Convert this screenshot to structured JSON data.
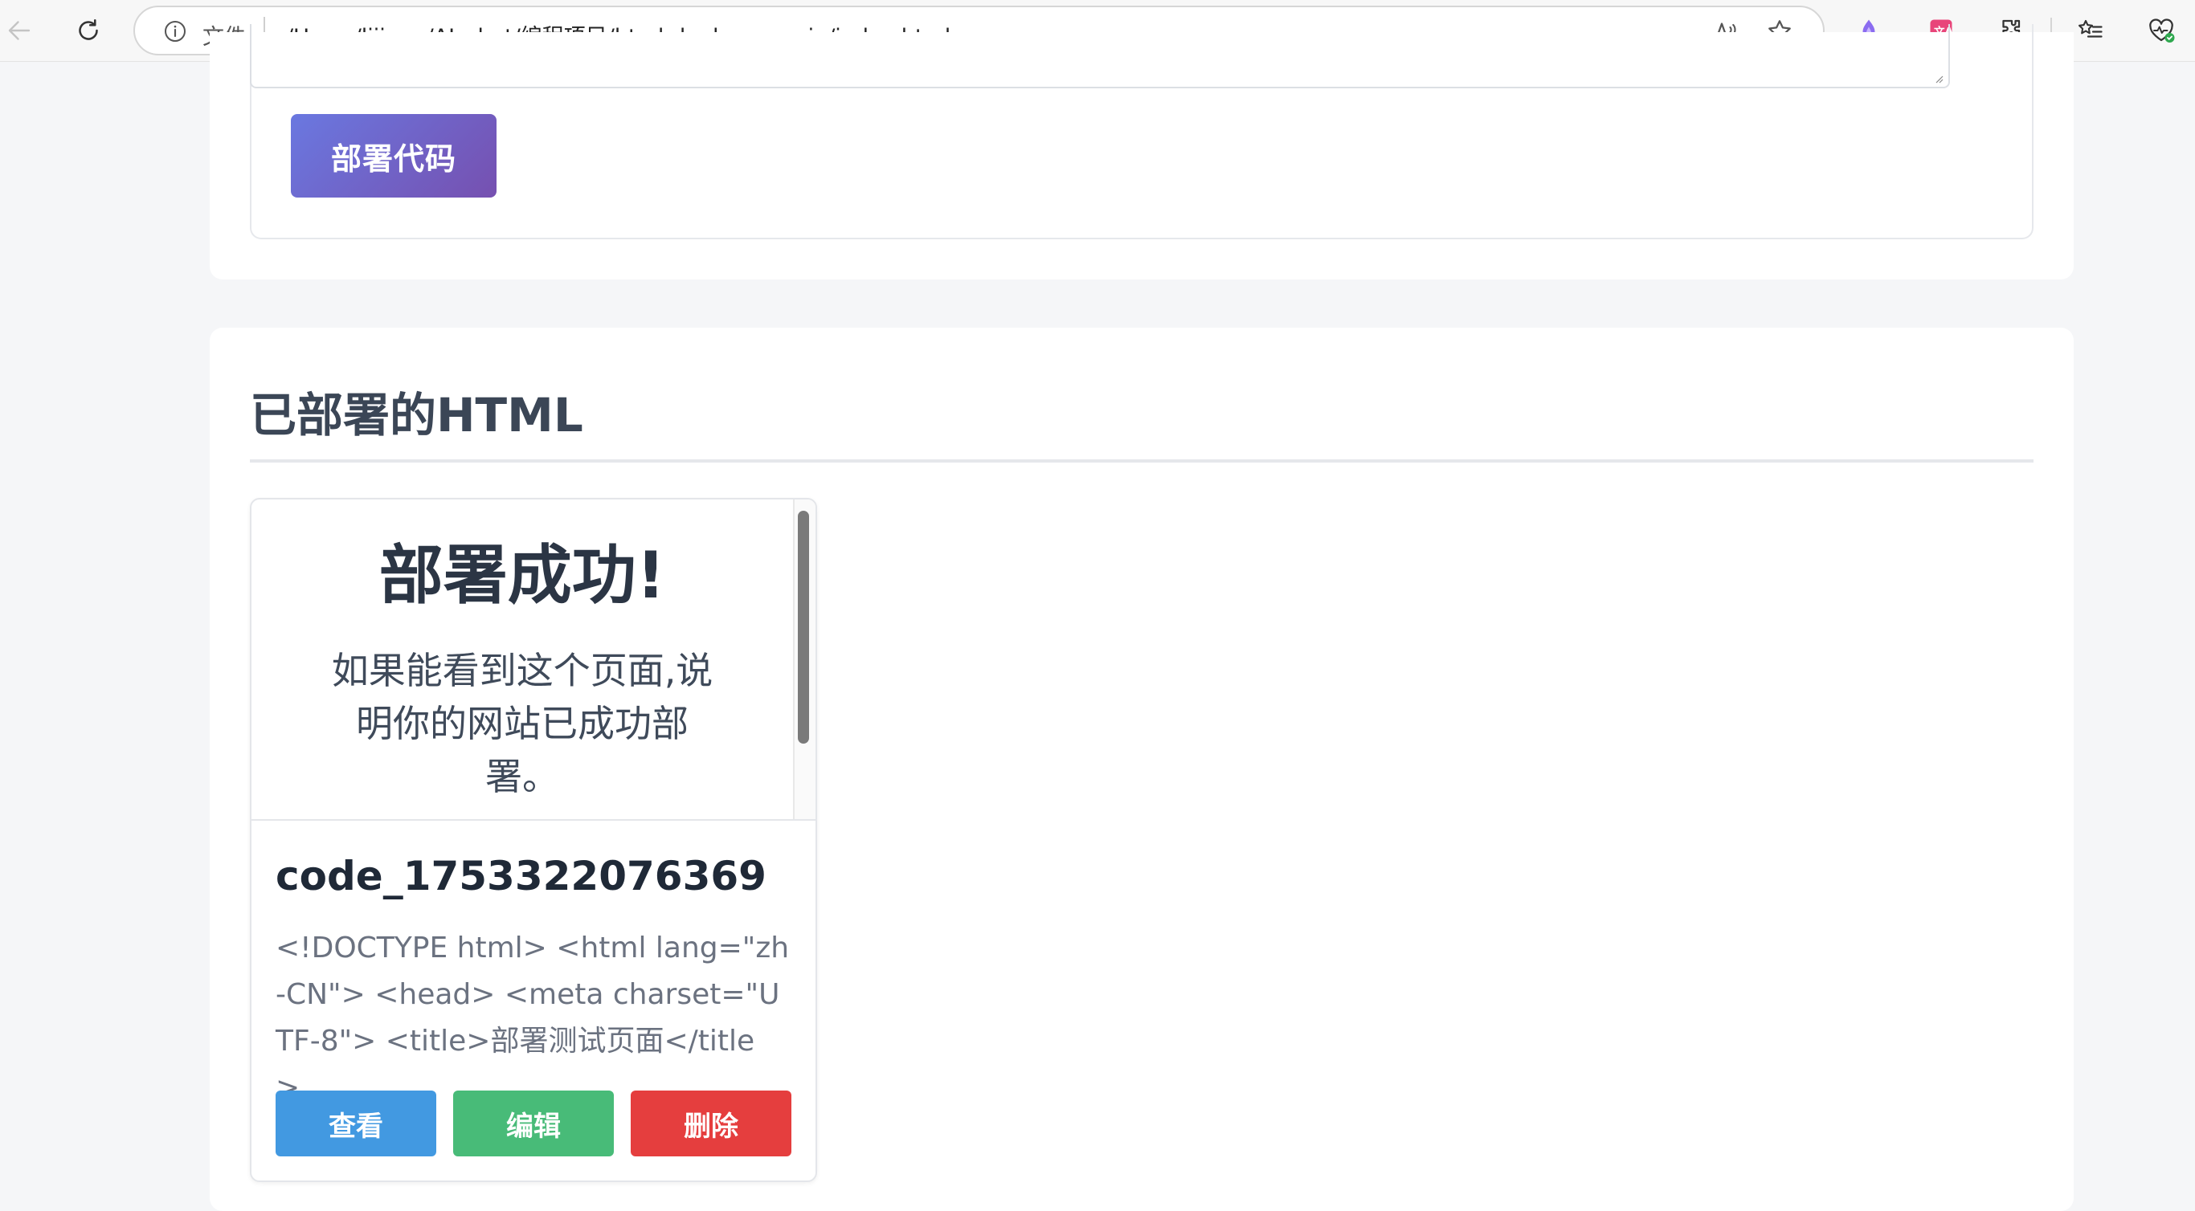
{
  "browser": {
    "address_prefix": "文件",
    "url": "/Users/lijiong/AI_chat/编程项目/html-deployer-main/index.html"
  },
  "deploy_form": {
    "deploy_button_label": "部署代码"
  },
  "deployed_section": {
    "title": "已部署的HTML",
    "cards": [
      {
        "preview_title": "部署成功!",
        "preview_text": "如果能看到这个页面,说明你的网站已成功部署。",
        "name": "code_1753322076369",
        "snippet": "<!DOCTYPE html> <html lang=\"zh-CN\"> <head> <meta charset=\"UTF-8\"> <title>部署测试页面</title>...",
        "view_label": "查看",
        "edit_label": "编辑",
        "delete_label": "删除"
      }
    ]
  },
  "colors": {
    "deploy_gradient_start": "#6a78e0",
    "deploy_gradient_end": "#7650b0",
    "view": "#4299e1",
    "edit": "#48bb78",
    "delete": "#e53e3e"
  }
}
